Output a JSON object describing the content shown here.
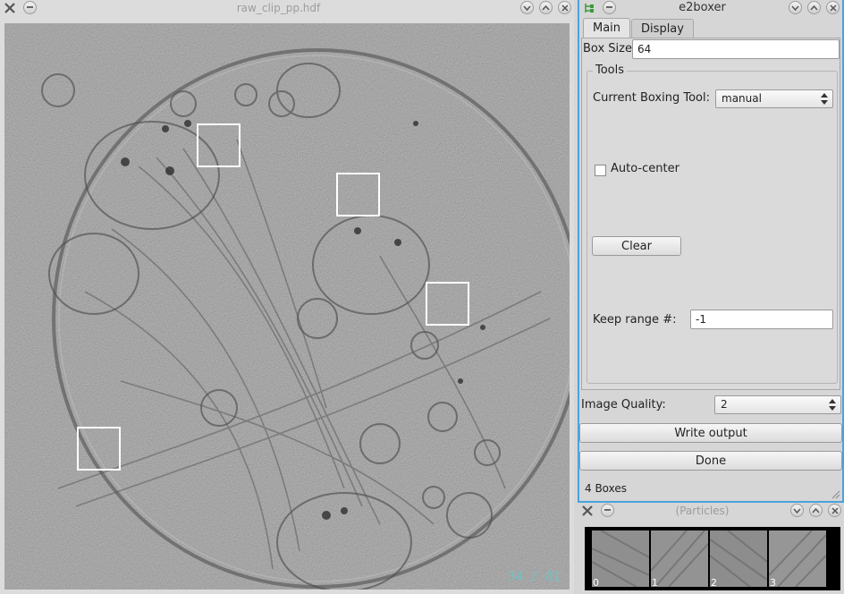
{
  "image_window": {
    "title": "raw_clip_pp.hdf",
    "frame_counter": "34 / 81",
    "boxes_count": 4
  },
  "boxer_window": {
    "title": "e2boxer",
    "tabs": [
      {
        "label": "Main",
        "active": true
      },
      {
        "label": "Display",
        "active": false
      }
    ],
    "box_size_label": "Box Size:",
    "box_size_value": "64",
    "tools_group": "Tools",
    "boxing_tool_label": "Current Boxing Tool:",
    "boxing_tool_value": "manual",
    "auto_center_label": "Auto-center",
    "auto_center_checked": false,
    "clear_button": "Clear",
    "keep_range_label": "Keep range #:",
    "keep_range_value": "-1",
    "image_quality_label": "Image Quality:",
    "image_quality_value": "2",
    "write_output_button": "Write output",
    "done_button": "Done",
    "status": "4 Boxes"
  },
  "particles_window": {
    "title": "(Particles)",
    "thumbnails": [
      "0",
      "1",
      "2",
      "3"
    ]
  },
  "colors": {
    "selection_border": "#4aa3df",
    "box_outline": "#ffffff",
    "counter_text": "#6fc4c6"
  }
}
